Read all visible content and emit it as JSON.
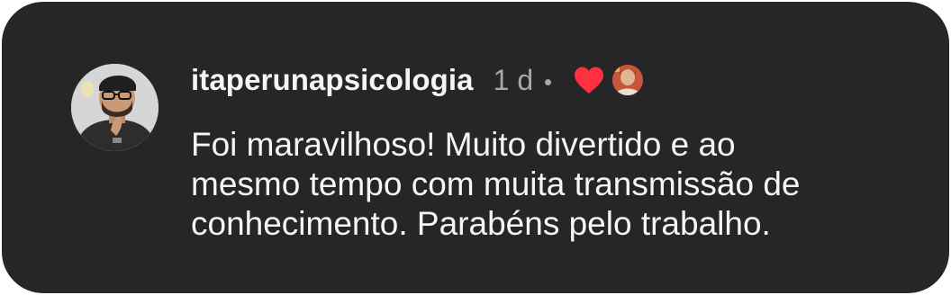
{
  "comment": {
    "username": "itaperunapsicologia",
    "timestamp": "1 d",
    "text_lines": [
      "Foi maravilhoso! Muito divertido e ao",
      "mesmo tempo com muita transmissão de",
      "conhecimento. Parabéns pelo trabalho."
    ],
    "liked_by_author": true,
    "icons": {
      "like": "heart-icon",
      "author_like_avatar": "creator-avatar"
    }
  },
  "colors": {
    "card_background": "#262626",
    "primary_text": "#f5f5f5",
    "secondary_text": "#a8a8a8",
    "heart": "#ff3040"
  }
}
